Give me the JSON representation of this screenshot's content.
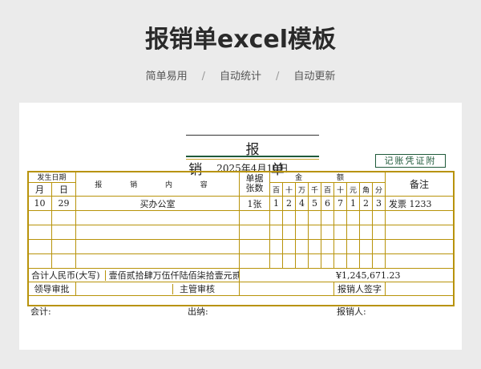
{
  "header": {
    "title": "报销单excel模板",
    "tags": [
      "简单易用",
      "自动统计",
      "自动更新"
    ],
    "separator": "/"
  },
  "form": {
    "title": "报 销 单",
    "date": "2025年4月10日",
    "stamp": "记账凭证附",
    "columns": {
      "date_group": "发生日期",
      "month": "月",
      "day": "日",
      "content": "报 销 内 容",
      "doc_count_1": "单据",
      "doc_count_2": "张数",
      "amount": "金 额",
      "digits": [
        "百",
        "十",
        "万",
        "千",
        "百",
        "十",
        "元",
        "角",
        "分"
      ],
      "remarks": "备注"
    },
    "rows": [
      {
        "month": "10",
        "day": "29",
        "content": "买办公室",
        "count": "1张",
        "digits": [
          "1",
          "2",
          "4",
          "5",
          "6",
          "7",
          "1",
          "2",
          "3"
        ],
        "remark": "发票 1233"
      },
      {
        "month": "",
        "day": "",
        "content": "",
        "count": "",
        "digits": [
          "",
          "",
          "",
          "",
          "",
          "",
          "",
          "",
          ""
        ],
        "remark": ""
      },
      {
        "month": "",
        "day": "",
        "content": "",
        "count": "",
        "digits": [
          "",
          "",
          "",
          "",
          "",
          "",
          "",
          "",
          ""
        ],
        "remark": ""
      },
      {
        "month": "",
        "day": "",
        "content": "",
        "count": "",
        "digits": [
          "",
          "",
          "",
          "",
          "",
          "",
          "",
          "",
          ""
        ],
        "remark": ""
      },
      {
        "month": "",
        "day": "",
        "content": "",
        "count": "",
        "digits": [
          "",
          "",
          "",
          "",
          "",
          "",
          "",
          "",
          ""
        ],
        "remark": ""
      }
    ],
    "total_label": "合计人民币(大写)",
    "total_words": "壹佰贰拾肆万伍仟陆佰柒拾壹元贰角叁分",
    "total_number": "¥1,245,671.23",
    "sign_leader": "领导审批",
    "sign_supervisor": "主管审核",
    "sign_claimant": "报销人签字",
    "footer_accountant": "会计:",
    "footer_cashier": "出纳:",
    "footer_claimant": "报销人:"
  }
}
